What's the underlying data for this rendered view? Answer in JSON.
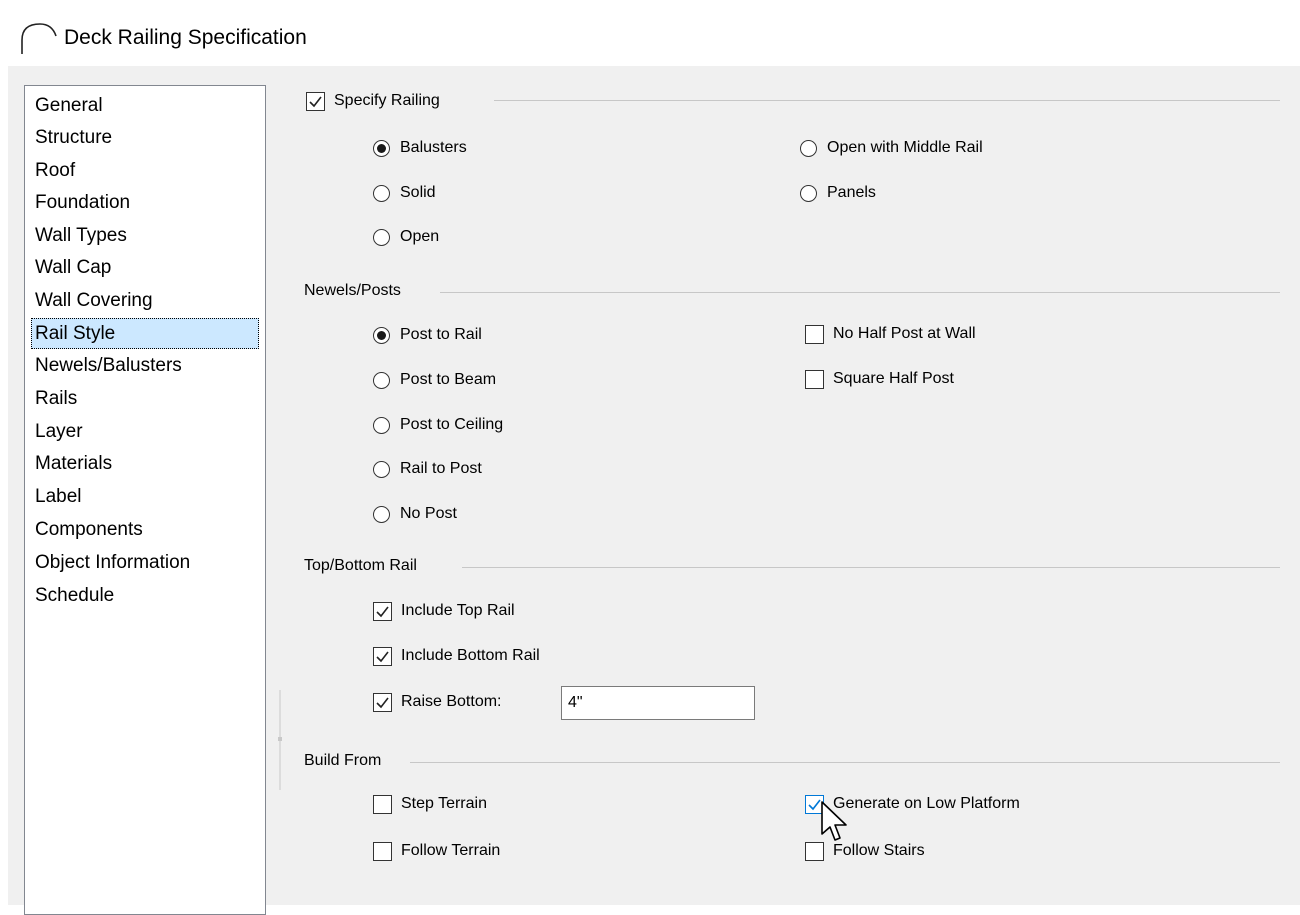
{
  "window": {
    "title": "Deck Railing Specification"
  },
  "nav": {
    "items": [
      "General",
      "Structure",
      "Roof",
      "Foundation",
      "Wall Types",
      "Wall Cap",
      "Wall Covering",
      "Rail Style",
      "Newels/Balusters",
      "Rails",
      "Layer",
      "Materials",
      "Label",
      "Components",
      "Object Information",
      "Schedule"
    ],
    "selected": "Rail Style"
  },
  "specify_railing": {
    "label": "Specify Railing",
    "checked": true,
    "options": [
      {
        "label": "Balusters",
        "selected": true
      },
      {
        "label": "Solid",
        "selected": false
      },
      {
        "label": "Open",
        "selected": false
      },
      {
        "label": "Open with Middle Rail",
        "selected": false
      },
      {
        "label": "Panels",
        "selected": false
      }
    ]
  },
  "newels_posts": {
    "title": "Newels/Posts",
    "options": [
      {
        "label": "Post to Rail",
        "selected": true
      },
      {
        "label": "Post to Beam",
        "selected": false
      },
      {
        "label": "Post to Ceiling",
        "selected": false
      },
      {
        "label": "Rail to Post",
        "selected": false
      },
      {
        "label": "No Post",
        "selected": false
      }
    ],
    "checks": [
      {
        "label": "No Half Post at Wall",
        "checked": false
      },
      {
        "label": "Square Half Post",
        "checked": false
      }
    ]
  },
  "top_bottom_rail": {
    "title": "Top/Bottom Rail",
    "include_top": {
      "label": "Include Top Rail",
      "checked": true
    },
    "include_bottom": {
      "label": "Include Bottom Rail",
      "checked": true
    },
    "raise_bottom": {
      "label": "Raise Bottom:",
      "checked": true,
      "value": "4\""
    }
  },
  "build_from": {
    "title": "Build From",
    "checks": [
      {
        "label": "Step Terrain",
        "checked": false
      },
      {
        "label": "Follow Terrain",
        "checked": false
      },
      {
        "label": "Generate on Low Platform",
        "checked": true
      },
      {
        "label": "Follow Stairs",
        "checked": false
      }
    ]
  },
  "colors": {
    "accent": "#0078d7",
    "selection": "#cce8ff",
    "dialog_bg": "#f0f0f0"
  }
}
